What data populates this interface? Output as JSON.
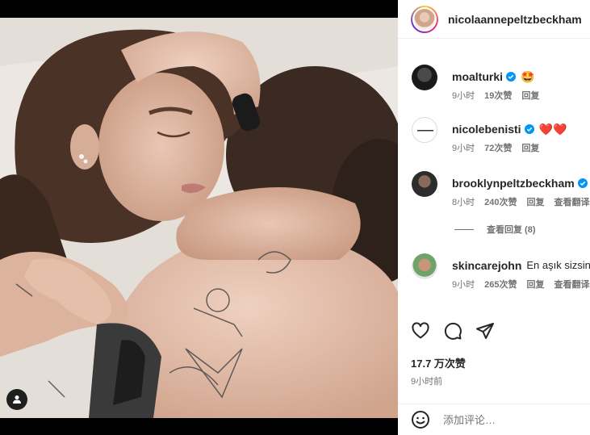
{
  "post": {
    "username": "nicolaannepeltzbeckham",
    "likes": "17.7 万次赞",
    "time": "9小时前"
  },
  "comments": [
    {
      "username": "moalturki",
      "text": "",
      "emoji": "🤩",
      "time": "9小时",
      "likes": "19次赞",
      "reply": "回复",
      "translate": ""
    },
    {
      "username": "nicolebenisti",
      "text": "",
      "emoji": "❤️❤️",
      "time": "9小时",
      "likes": "72次赞",
      "reply": "回复",
      "translate": ""
    },
    {
      "username": "brooklynpeltzbeckham",
      "text": "",
      "emoji": "",
      "time": "8小时",
      "likes": "240次赞",
      "reply": "回复",
      "translate": "查看翻译"
    },
    {
      "username": "skincarejohn",
      "text": "En aşık sizsiniz",
      "emoji": "",
      "time": "9小时",
      "likes": "265次赞",
      "reply": "回复",
      "translate": "查看翻译"
    }
  ],
  "view_replies": "查看回复 (8)",
  "add_comment": {
    "placeholder": "添加评论…"
  },
  "colors": {
    "verified": "#0095f6",
    "heart": "#ed4956",
    "muted": "#737373",
    "text": "#262626"
  }
}
